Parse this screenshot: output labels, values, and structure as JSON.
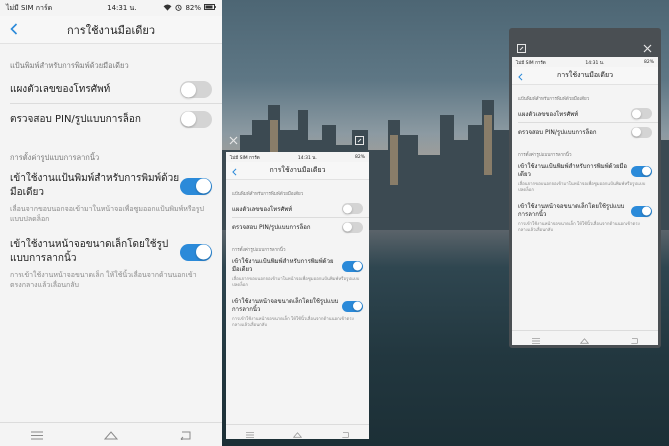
{
  "status": {
    "carrier": "ไม่มี SIM การ์ด",
    "time": "14:31 น.",
    "battery": "82%"
  },
  "header": {
    "title": "การใช้งานมือเดียว"
  },
  "section1": {
    "title": "แป้นพิมพ์สำหรับการพิมพ์ด้วยมือเดียว"
  },
  "rows": {
    "dialpad": "แผงตัวเลขของโทรศัพท์",
    "pin": "ตรวจสอบ PIN/รูปแบบการล็อก"
  },
  "section2": {
    "title": "การตั้งค่ารูปแบบการลากนิ้ว"
  },
  "keyboard": {
    "label": "เข้าใช้งานแป้นพิมพ์สำหรับการพิมพ์ด้วยมือเดียว",
    "desc": "เลื่อนจากขอบนอกจอเข้ามาในหน้าจอเพื่อซูมออกแป้นพิมพ์หรือรูปแบบปลดล็อก"
  },
  "smallscreen": {
    "label": "เข้าใช้งานหน้าจอขนาดเล็กโดยใช้รูปแบบการลากนิ้ว",
    "desc": "การเข้าใช้งานหน้าจอขนาดเล็ก ให้ใช้นิ้วเลื่อนจากด้านนอกเข้าตรงกลางแล้วเลื่อนกลับ"
  },
  "icons": {
    "back": "chevron-left-icon",
    "menu": "menu-icon",
    "home": "home-icon",
    "return": "return-icon",
    "close": "close-icon",
    "resize": "resize-icon",
    "wifi": "wifi-icon",
    "alarm": "alarm-icon",
    "battery": "battery-icon"
  },
  "colors": {
    "accent": "#2b8ad9",
    "toggle_off": "#d4d4d4",
    "background": "#f4f4f4"
  }
}
